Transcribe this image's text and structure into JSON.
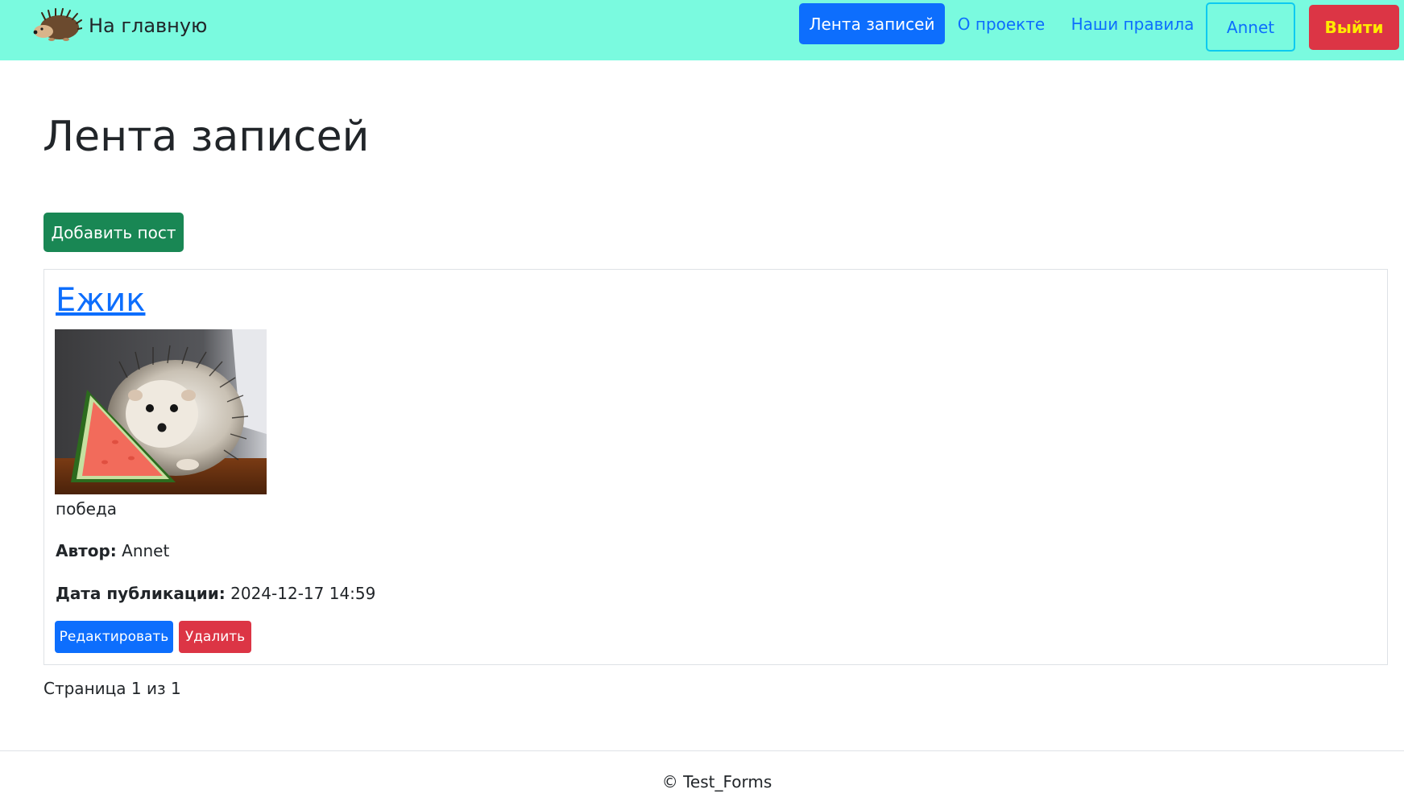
{
  "navbar": {
    "brand_text": "На главную",
    "brand_icon": "hedgehog-logo",
    "background": "#7afadf",
    "items": [
      {
        "label": "Лента записей"
      },
      {
        "label": "О проекте"
      },
      {
        "label": "Наши правила"
      }
    ],
    "user_label": "Annet",
    "logout_label": "Выйти"
  },
  "page": {
    "title": "Лента записей",
    "add_button": "Добавить пост"
  },
  "post": {
    "title": "Ежик",
    "image_alt": "hedgehog-with-watermelon",
    "body": "победа",
    "author_label": "Автор:",
    "author_value": "Annet",
    "date_label": "Дата публикации:",
    "date_value": "2024-12-17 14:59",
    "edit_button": "Редактировать",
    "delete_button": "Удалить"
  },
  "pagination": {
    "text": "Страница 1 из 1"
  },
  "footer": {
    "text": "© Test_Forms"
  },
  "colors": {
    "primary": "#0d6efd",
    "success": "#198754",
    "danger": "#dc3545",
    "logout_text": "#ffea00",
    "user_border": "#0dcaf0"
  }
}
